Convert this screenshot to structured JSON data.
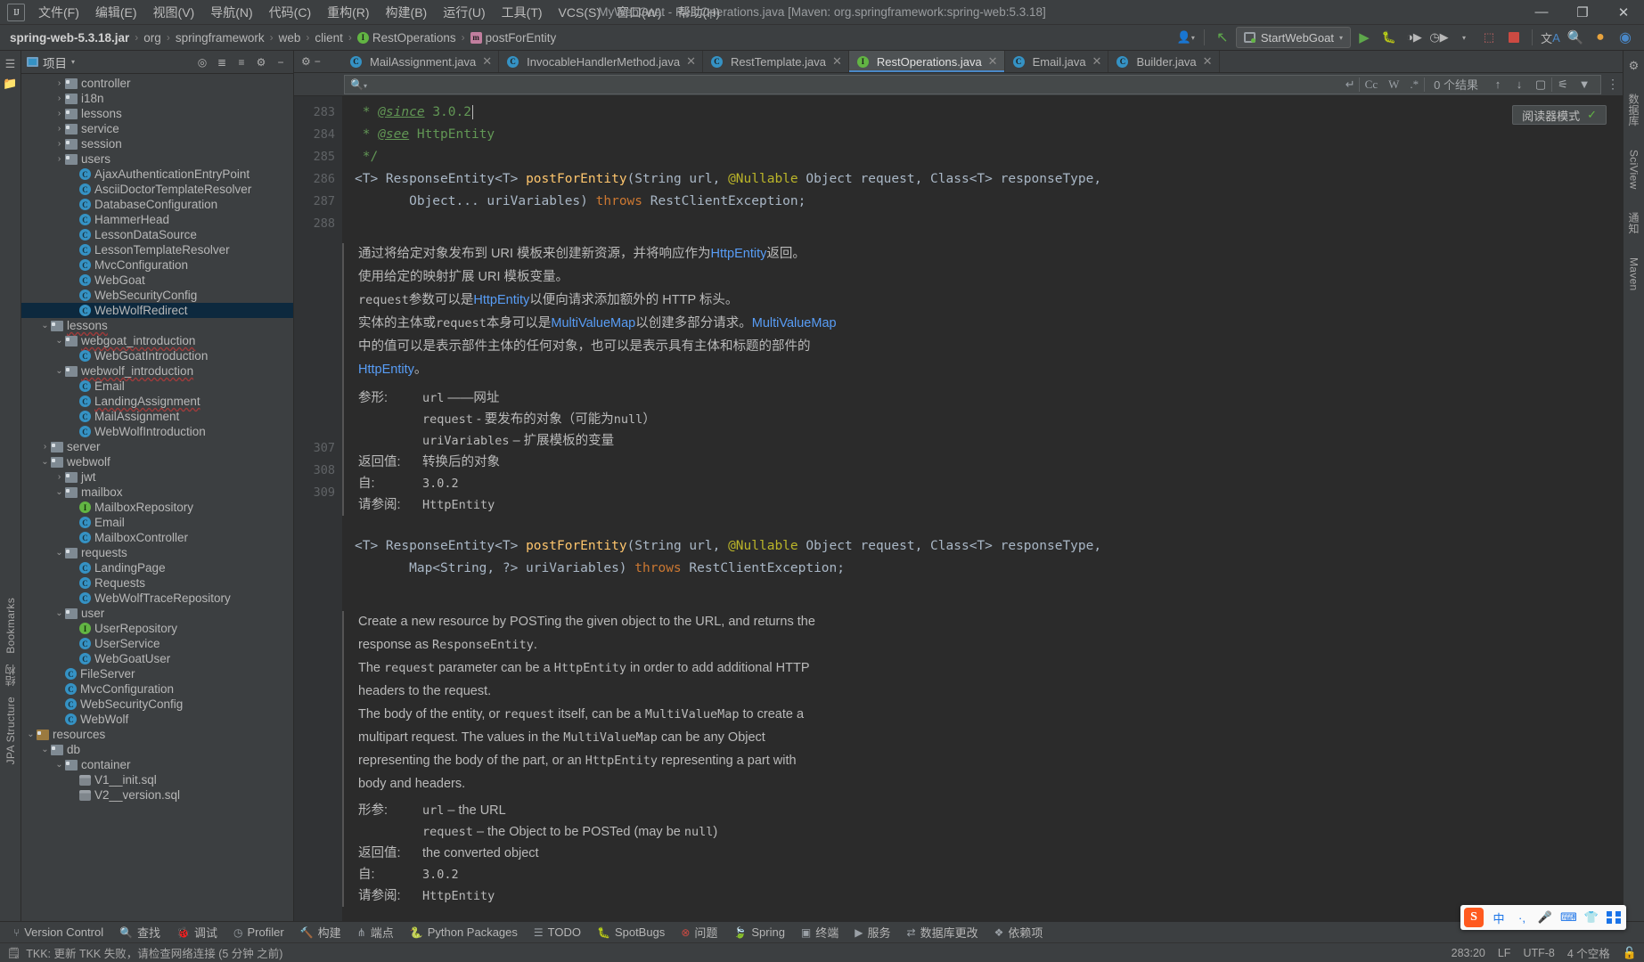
{
  "window": {
    "title": "MyWebGoat - RestOperations.java [Maven: org.springframework:spring-web:5.3.18]",
    "minimize": "—",
    "maximize": "❐",
    "close": "✕"
  },
  "menu": {
    "logo": "IJ",
    "items": [
      {
        "label": "文件(F)",
        "name": "menu-file"
      },
      {
        "label": "编辑(E)",
        "name": "menu-edit"
      },
      {
        "label": "视图(V)",
        "name": "menu-view"
      },
      {
        "label": "导航(N)",
        "name": "menu-navigate"
      },
      {
        "label": "代码(C)",
        "name": "menu-code"
      },
      {
        "label": "重构(R)",
        "name": "menu-refactor"
      },
      {
        "label": "构建(B)",
        "name": "menu-build"
      },
      {
        "label": "运行(U)",
        "name": "menu-run"
      },
      {
        "label": "工具(T)",
        "name": "menu-tools"
      },
      {
        "label": "VCS(S)",
        "name": "menu-vcs"
      },
      {
        "label": "窗口(W)",
        "name": "menu-window"
      },
      {
        "label": "帮助(H)",
        "name": "menu-help"
      }
    ]
  },
  "breadcrumb": {
    "items": [
      {
        "label": "spring-web-5.3.18.jar",
        "icon": "",
        "bold": true
      },
      {
        "label": "org",
        "icon": ""
      },
      {
        "label": "springframework",
        "icon": ""
      },
      {
        "label": "web",
        "icon": ""
      },
      {
        "label": "client",
        "icon": ""
      },
      {
        "label": "RestOperations",
        "icon": "interface-icon"
      },
      {
        "label": "postForEntity",
        "icon": "method-icon"
      }
    ],
    "separator": "›"
  },
  "toolbar": {
    "run_config": "StartWebGoat",
    "run_tooltip": "运行",
    "stop_tooltip": "停止",
    "icons": [
      "user-icon",
      "update-project-icon",
      "run-icon",
      "debug-icon",
      "run-with-coverage-icon",
      "profiler-icon",
      "stop-icon",
      "translate-icon",
      "search-everywhere-icon",
      "notifications-icon",
      "ide-assistant-icon"
    ]
  },
  "project_panel": {
    "title": "项目",
    "header_icons": [
      "locate-icon",
      "expand-all-icon",
      "collapse-all-icon",
      "settings-icon",
      "hide-icon"
    ],
    "tree": [
      {
        "label": "controller",
        "depth": 3,
        "arrow": "collapsed",
        "icon": "folder"
      },
      {
        "label": "i18n",
        "depth": 3,
        "arrow": "collapsed",
        "icon": "folder"
      },
      {
        "label": "lessons",
        "depth": 3,
        "arrow": "collapsed",
        "icon": "folder"
      },
      {
        "label": "service",
        "depth": 3,
        "arrow": "collapsed",
        "icon": "folder"
      },
      {
        "label": "session",
        "depth": 3,
        "arrow": "collapsed",
        "icon": "folder"
      },
      {
        "label": "users",
        "depth": 3,
        "arrow": "collapsed",
        "icon": "folder"
      },
      {
        "label": "AjaxAuthenticationEntryPoint",
        "depth": 4,
        "arrow": "none",
        "icon": "class"
      },
      {
        "label": "AsciiDoctorTemplateResolver",
        "depth": 4,
        "arrow": "none",
        "icon": "class"
      },
      {
        "label": "DatabaseConfiguration",
        "depth": 4,
        "arrow": "none",
        "icon": "class"
      },
      {
        "label": "HammerHead",
        "depth": 4,
        "arrow": "none",
        "icon": "class"
      },
      {
        "label": "LessonDataSource",
        "depth": 4,
        "arrow": "none",
        "icon": "class"
      },
      {
        "label": "LessonTemplateResolver",
        "depth": 4,
        "arrow": "none",
        "icon": "class"
      },
      {
        "label": "MvcConfiguration",
        "depth": 4,
        "arrow": "none",
        "icon": "class"
      },
      {
        "label": "WebGoat",
        "depth": 4,
        "arrow": "none",
        "icon": "class-runnable"
      },
      {
        "label": "WebSecurityConfig",
        "depth": 4,
        "arrow": "none",
        "icon": "class"
      },
      {
        "label": "WebWolfRedirect",
        "depth": 4,
        "arrow": "none",
        "icon": "class",
        "selected": true
      },
      {
        "label": "lessons",
        "depth": 2,
        "arrow": "expanded",
        "icon": "folder",
        "spell": true
      },
      {
        "label": "webgoat_introduction",
        "depth": 3,
        "arrow": "expanded",
        "icon": "folder",
        "spell": true
      },
      {
        "label": "WebGoatIntroduction",
        "depth": 4,
        "arrow": "none",
        "icon": "class"
      },
      {
        "label": "webwolf_introduction",
        "depth": 3,
        "arrow": "expanded",
        "icon": "folder",
        "spell": true
      },
      {
        "label": "Email",
        "depth": 4,
        "arrow": "none",
        "icon": "class"
      },
      {
        "label": "LandingAssignment",
        "depth": 4,
        "arrow": "none",
        "icon": "class",
        "spell": true
      },
      {
        "label": "MailAssignment",
        "depth": 4,
        "arrow": "none",
        "icon": "class"
      },
      {
        "label": "WebWolfIntroduction",
        "depth": 4,
        "arrow": "none",
        "icon": "class"
      },
      {
        "label": "server",
        "depth": 2,
        "arrow": "collapsed",
        "icon": "folder"
      },
      {
        "label": "webwolf",
        "depth": 2,
        "arrow": "expanded",
        "icon": "folder"
      },
      {
        "label": "jwt",
        "depth": 3,
        "arrow": "collapsed",
        "icon": "folder"
      },
      {
        "label": "mailbox",
        "depth": 3,
        "arrow": "expanded",
        "icon": "folder"
      },
      {
        "label": "MailboxRepository",
        "depth": 4,
        "arrow": "none",
        "icon": "interface"
      },
      {
        "label": "Email",
        "depth": 4,
        "arrow": "none",
        "icon": "class"
      },
      {
        "label": "MailboxController",
        "depth": 4,
        "arrow": "none",
        "icon": "class"
      },
      {
        "label": "requests",
        "depth": 3,
        "arrow": "expanded",
        "icon": "folder"
      },
      {
        "label": "LandingPage",
        "depth": 4,
        "arrow": "none",
        "icon": "class"
      },
      {
        "label": "Requests",
        "depth": 4,
        "arrow": "none",
        "icon": "class"
      },
      {
        "label": "WebWolfTraceRepository",
        "depth": 4,
        "arrow": "none",
        "icon": "class"
      },
      {
        "label": "user",
        "depth": 3,
        "arrow": "expanded",
        "icon": "folder"
      },
      {
        "label": "UserRepository",
        "depth": 4,
        "arrow": "none",
        "icon": "interface"
      },
      {
        "label": "UserService",
        "depth": 4,
        "arrow": "none",
        "icon": "class"
      },
      {
        "label": "WebGoatUser",
        "depth": 4,
        "arrow": "none",
        "icon": "class"
      },
      {
        "label": "FileServer",
        "depth": 3,
        "arrow": "none",
        "icon": "class"
      },
      {
        "label": "MvcConfiguration",
        "depth": 3,
        "arrow": "none",
        "icon": "class"
      },
      {
        "label": "WebSecurityConfig",
        "depth": 3,
        "arrow": "none",
        "icon": "class"
      },
      {
        "label": "WebWolf",
        "depth": 3,
        "arrow": "none",
        "icon": "class"
      },
      {
        "label": "resources",
        "depth": 1,
        "arrow": "expanded",
        "icon": "resources"
      },
      {
        "label": "db",
        "depth": 2,
        "arrow": "expanded",
        "icon": "folder"
      },
      {
        "label": "container",
        "depth": 3,
        "arrow": "expanded",
        "icon": "folder"
      },
      {
        "label": "V1__init.sql",
        "depth": 4,
        "arrow": "none",
        "icon": "sql"
      },
      {
        "label": "V2__version.sql",
        "depth": 4,
        "arrow": "none",
        "icon": "sql"
      }
    ]
  },
  "editor": {
    "tabs": [
      {
        "label": "MailAssignment.java",
        "icon": "class",
        "active": false
      },
      {
        "label": "InvocableHandlerMethod.java",
        "icon": "class",
        "active": false
      },
      {
        "label": "RestTemplate.java",
        "icon": "class",
        "active": false
      },
      {
        "label": "RestOperations.java",
        "icon": "interface",
        "active": true
      },
      {
        "label": "Email.java",
        "icon": "class",
        "active": false
      },
      {
        "label": "Builder.java",
        "icon": "class",
        "active": false
      }
    ],
    "tab_close": "✕",
    "gutter_icons": [
      "settings-icon",
      "minimize-icon"
    ]
  },
  "find": {
    "placeholder": "",
    "value": "",
    "result_count": "0 个结果",
    "match_case": "Cc",
    "words": "W",
    "regex": ".*",
    "wrap_icon": "↵",
    "prev": "↑",
    "next": "↓",
    "select_all": "▢",
    "filter": "⚟",
    "filter2": "▼"
  },
  "reader_mode": {
    "label": "阅读器模式",
    "check": "✓"
  },
  "code": {
    "lines": [
      {
        "num": "283",
        "badge": null
      },
      {
        "num": "284",
        "badge": null
      },
      {
        "num": "285",
        "badge": null
      },
      {
        "num": "286",
        "badge": "1"
      },
      {
        "num": "287",
        "badge": null
      },
      {
        "num": "288",
        "badge": null
      },
      {
        "num": "307",
        "badge": "1"
      },
      {
        "num": "308",
        "badge": null
      },
      {
        "num": "309",
        "badge": null
      }
    ],
    "src": {
      "l283": " * @since 3.0.2",
      "l284": " * @see HttpEntity",
      "l285": " */",
      "l286a": "<T> ResponseEntity<T> postForEntity(String url, @Nullable Object request, Class<T> responseType,",
      "l287a": "Object... uriVariables) throws RestClientException;",
      "l307a": "<T> ResponseEntity<T> postForEntity(String url, @Nullable Object request, Class<T> responseType,",
      "l308a": "Map<String, ?> uriVariables) throws RestClientException;"
    }
  },
  "doc_cn": {
    "p1_a": "通过将给定对象发布到 URI 模板来创建新资源，并将响应作为",
    "p1_link": "HttpEntity",
    "p1_b": "返回。",
    "p2": "使用给定的映射扩展 URI 模板变量。",
    "p3_a": "request",
    "p3_b": "参数可以是",
    "p3_link": "HttpEntity",
    "p3_c": "以便向请求添加额外的 HTTP 标头。",
    "p4_a": "实体的主体或",
    "p4_b": "request",
    "p4_c": "本身可以是",
    "p4_link": "MultiValueMap",
    "p4_d": "以创建多部分请求。",
    "p4_link2": "MultiValueMap",
    "p4_e": "中的值可以是表示部件主体的任何对象，也可以是表示具有主体和标题的部件的",
    "p4_link3": "HttpEntity",
    "p4_f": "。",
    "params_label": "参形:",
    "param1_k": "url",
    "param1_v": "——网址",
    "param2_k": "request",
    "param2_v": "- 要发布的对象（可能为",
    "param2_v2": "null",
    "param2_v3": "）",
    "param3_k": "uriVariables",
    "param3_v": "– 扩展模板的变量",
    "returns_label": "返回值:",
    "returns_val": "转换后的对象",
    "since_label": "自:",
    "since_val": "3.0.2",
    "see_label": "请参阅:",
    "see_val": "HttpEntity"
  },
  "doc_en": {
    "p1_a": "Create a new resource by POSTing the given object to the URL, and returns the",
    "p1_b": "response as ",
    "p1_link": "ResponseEntity",
    "p1_c": ".",
    "p2_a": "The ",
    "p2_mono": "request",
    "p2_b": " parameter can be a ",
    "p2_link": "HttpEntity",
    "p2_c": " in order to add additional HTTP",
    "p2_d": "headers to the request.",
    "p3_a": "The body of the entity, or ",
    "p3_mono": "request",
    "p3_b": " itself, can be a ",
    "p3_link": "MultiValueMap",
    "p3_c": " to create a",
    "p3_d": "multipart request. The values in the ",
    "p3_link2": "MultiValueMap",
    "p3_e": " can be any Object",
    "p3_f": "representing the body of the part, or an ",
    "p3_link3": "HttpEntity",
    "p3_g": " representing a part with",
    "p3_h": "body and headers.",
    "params_label": "形参:",
    "param1_k": "url",
    "param1_v": "– the URL",
    "param2_k": "request",
    "param2_v": "– the Object to be POSTed (may be ",
    "param2_v2": "null",
    "param2_v3": ")",
    "returns_label": "返回值:",
    "returns_val": "the converted object",
    "since_label": "自:",
    "since_val": "3.0.2",
    "see_label": "请参阅:",
    "see_val": "HttpEntity"
  },
  "left_stripe": {
    "items": [
      {
        "label": "项目",
        "name": "tool-window-project"
      },
      {
        "label": "Bookmarks",
        "name": "tool-window-bookmarks"
      },
      {
        "label": "结构",
        "name": "tool-window-structure"
      },
      {
        "label": "JPA Structure",
        "name": "tool-window-jpa-structure"
      }
    ]
  },
  "right_stripe": {
    "items": [
      {
        "label": "数据库",
        "name": "tool-window-database"
      },
      {
        "label": "SciView",
        "name": "tool-window-sciview"
      },
      {
        "label": "通知",
        "name": "tool-window-notifications"
      },
      {
        "label": "Maven",
        "name": "tool-window-maven"
      }
    ]
  },
  "bottom_tools": {
    "items": [
      {
        "label": "Version Control",
        "icon": "branch-icon",
        "name": "tool-version-control"
      },
      {
        "label": "查找",
        "icon": "search-icon",
        "name": "tool-find"
      },
      {
        "label": "调试",
        "icon": "debug-icon",
        "name": "tool-debug"
      },
      {
        "label": "Profiler",
        "icon": "profiler-icon",
        "name": "tool-profiler"
      },
      {
        "label": "构建",
        "icon": "build-icon",
        "name": "tool-build"
      },
      {
        "label": "端点",
        "icon": "endpoints-icon",
        "name": "tool-endpoints"
      },
      {
        "label": "Python Packages",
        "icon": "python-icon",
        "name": "tool-python-packages"
      },
      {
        "label": "TODO",
        "icon": "todo-icon",
        "name": "tool-todo"
      },
      {
        "label": "SpotBugs",
        "icon": "spotbugs-icon",
        "name": "tool-spotbugs"
      },
      {
        "label": "问题",
        "icon": "problems-icon",
        "name": "tool-problems"
      },
      {
        "label": "Spring",
        "icon": "spring-icon",
        "name": "tool-spring"
      },
      {
        "label": "终端",
        "icon": "terminal-icon",
        "name": "tool-terminal"
      },
      {
        "label": "服务",
        "icon": "services-icon",
        "name": "tool-services"
      },
      {
        "label": "数据库更改",
        "icon": "db-changes-icon",
        "name": "tool-db-changes"
      },
      {
        "label": "依赖项",
        "icon": "dependencies-icon",
        "name": "tool-dependencies"
      }
    ]
  },
  "statusbar": {
    "message": "TKK: 更新 TKK 失败，请检查网络连接 (5 分钟 之前)",
    "message_icon": "event-log-icon",
    "caret": "283:20",
    "line_sep": "LF",
    "encoding": "UTF-8",
    "indent": "4 个空格",
    "lock": "read-only-icon"
  },
  "ime": {
    "logo": "S",
    "mode": "中",
    "punct": "·,",
    "mic": "🎤",
    "keyboard": "⌨",
    "skin": "👕",
    "apps": "⠿"
  },
  "colors": {
    "accent": "#4a88c7",
    "bg": "#3c3f41",
    "editor_bg": "#2b2b2b",
    "selection": "#0d293e",
    "keyword": "#cc7832",
    "string": "#6a8759",
    "doc": "#629755",
    "annotation": "#bbb529",
    "method": "#ffc66d",
    "link": "#589df6",
    "interface_icon": "#62b543",
    "class_icon": "#3592c4"
  }
}
